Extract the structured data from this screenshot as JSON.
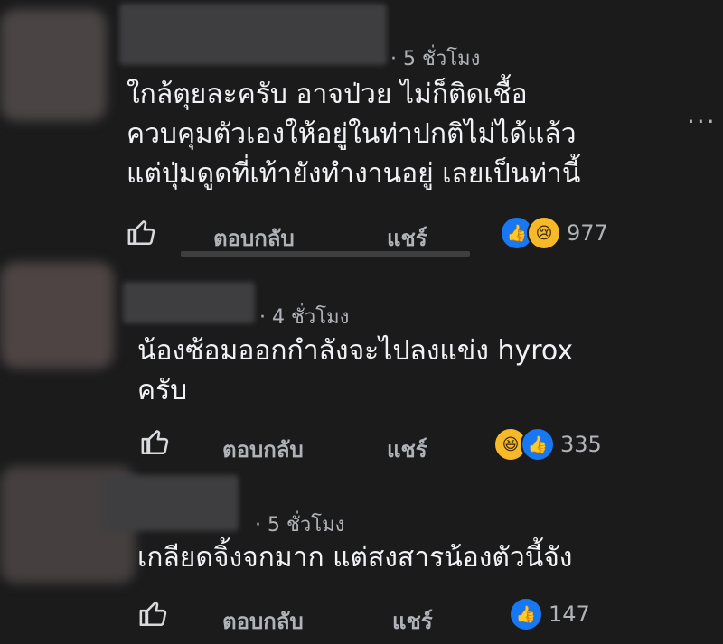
{
  "comments": [
    {
      "time": "· 5 ชั่วโมง",
      "text": "ใกล้ตุยละครับ อาจป่วย ไม่ก็ติดเชื้อ\nควบคุมตัวเองให้อยู่ในท่าปกติไม่ได้แล้ว\nแต่ปุ่มดูดที่เท้ายังทำงานอยู่ เลยเป็นท่านี้",
      "reply_label": "ตอบกลับ",
      "share_label": "แชร์",
      "reaction_icons": [
        "like-icon",
        "sad-icon"
      ],
      "reaction_count": "977"
    },
    {
      "time": "· 4 ชั่วโมง",
      "text": "น้องซ้อมออกกำลังจะไปลงแข่ง hyrox\nครับ",
      "reply_label": "ตอบกลับ",
      "share_label": "แชร์",
      "reaction_icons": [
        "haha-icon",
        "like-icon"
      ],
      "reaction_count": "335"
    },
    {
      "time": "· 5 ชั่วโมง",
      "text": "เกลียดจิ้งจกมาก แต่สงสารน้องตัวนี้จัง",
      "reply_label": "ตอบกลับ",
      "share_label": "แชร์",
      "reaction_icons": [
        "like-icon"
      ],
      "reaction_count": "147"
    }
  ],
  "more_options_label": "···",
  "colors": {
    "background": "#1b1b1c",
    "text": "#f0f2f5",
    "muted": "#b0b3b8",
    "like_blue": "#1877f2",
    "emoji_yellow": "#f7b928"
  }
}
